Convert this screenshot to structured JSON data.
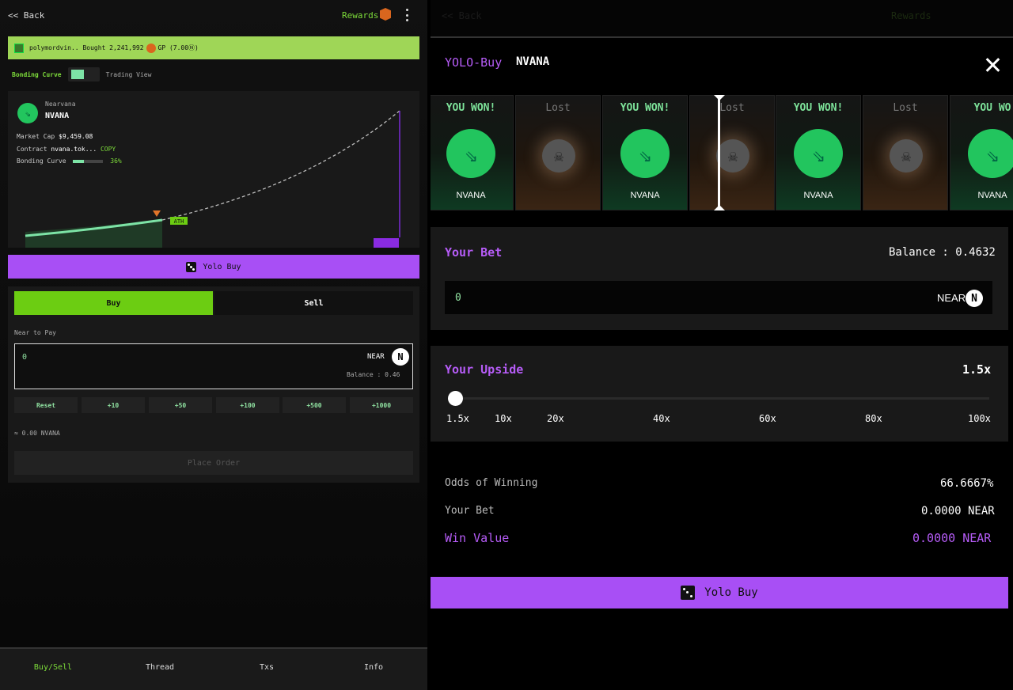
{
  "left": {
    "back": "<< Back",
    "rewards": "Rewards",
    "ticker": {
      "user": "polymordvin..",
      "action": "Bought 2,241,992",
      "unit": "GP (7.00",
      "near_glyph": "Ⓝ",
      "close": ")"
    },
    "toggle": {
      "left": "Bonding Curve",
      "right": "Trading View"
    },
    "token": {
      "sub": "Nearvana",
      "name": "NVANA",
      "logo_glyph": "⇘"
    },
    "market_cap_label": "Market Cap",
    "market_cap": "$9,459.08",
    "contract_label": "Contract",
    "contract": "nvana.tok...",
    "copy": "COPY",
    "bonding_label": "Bonding Curve",
    "bonding_pct": "36%",
    "bonding_progress": 0.36,
    "ath": "ATH",
    "yolo_label": "Yolo Buy",
    "tabs": {
      "buy": "Buy",
      "sell": "Sell"
    },
    "near_to_pay": "Near to Pay",
    "input": {
      "value": "0",
      "currency": "NEAR",
      "near_glyph": "N",
      "balance": "Balance : 0.46"
    },
    "quick": [
      "Reset",
      "+10",
      "+50",
      "+100",
      "+500",
      "+1000"
    ],
    "approx": "≈ 0.00 NVANA",
    "place_order": "Place Order",
    "nav": [
      "Buy/Sell",
      "Thread",
      "Txs",
      "Info"
    ],
    "accent": "#7ddc3a"
  },
  "modal": {
    "title1": "YOLO-Buy",
    "title2": "NVANA",
    "reel": [
      {
        "result": "YOU WON!",
        "label": "NVANA",
        "won": true
      },
      {
        "result": "Lost",
        "label": "",
        "won": false
      },
      {
        "result": "YOU WON!",
        "label": "NVANA",
        "won": true
      },
      {
        "result": "Lost",
        "label": "",
        "won": false
      },
      {
        "result": "YOU WON!",
        "label": "NVANA",
        "won": true
      },
      {
        "result": "Lost",
        "label": "",
        "won": false
      },
      {
        "result": "YOU WO",
        "label": "NVANA",
        "won": true
      }
    ],
    "bet_title": "Your Bet",
    "balance": "Balance : 0.4632",
    "bet_value": "0",
    "bet_currency": "NEAR",
    "near_glyph": "N",
    "upside_title": "Your Upside",
    "upside_value": "1.5x",
    "ticks": [
      "1.5x",
      "10x",
      "20x",
      "40x",
      "60x",
      "80x",
      "100x"
    ],
    "odds_label": "Odds of Winning",
    "odds": "66.6667%",
    "your_bet_label": "Your Bet",
    "your_bet": "0.0000 NEAR",
    "win_label": "Win Value",
    "win": "0.0000 NEAR",
    "yolo_label": "Yolo Buy",
    "accent": "#b65cf7"
  }
}
